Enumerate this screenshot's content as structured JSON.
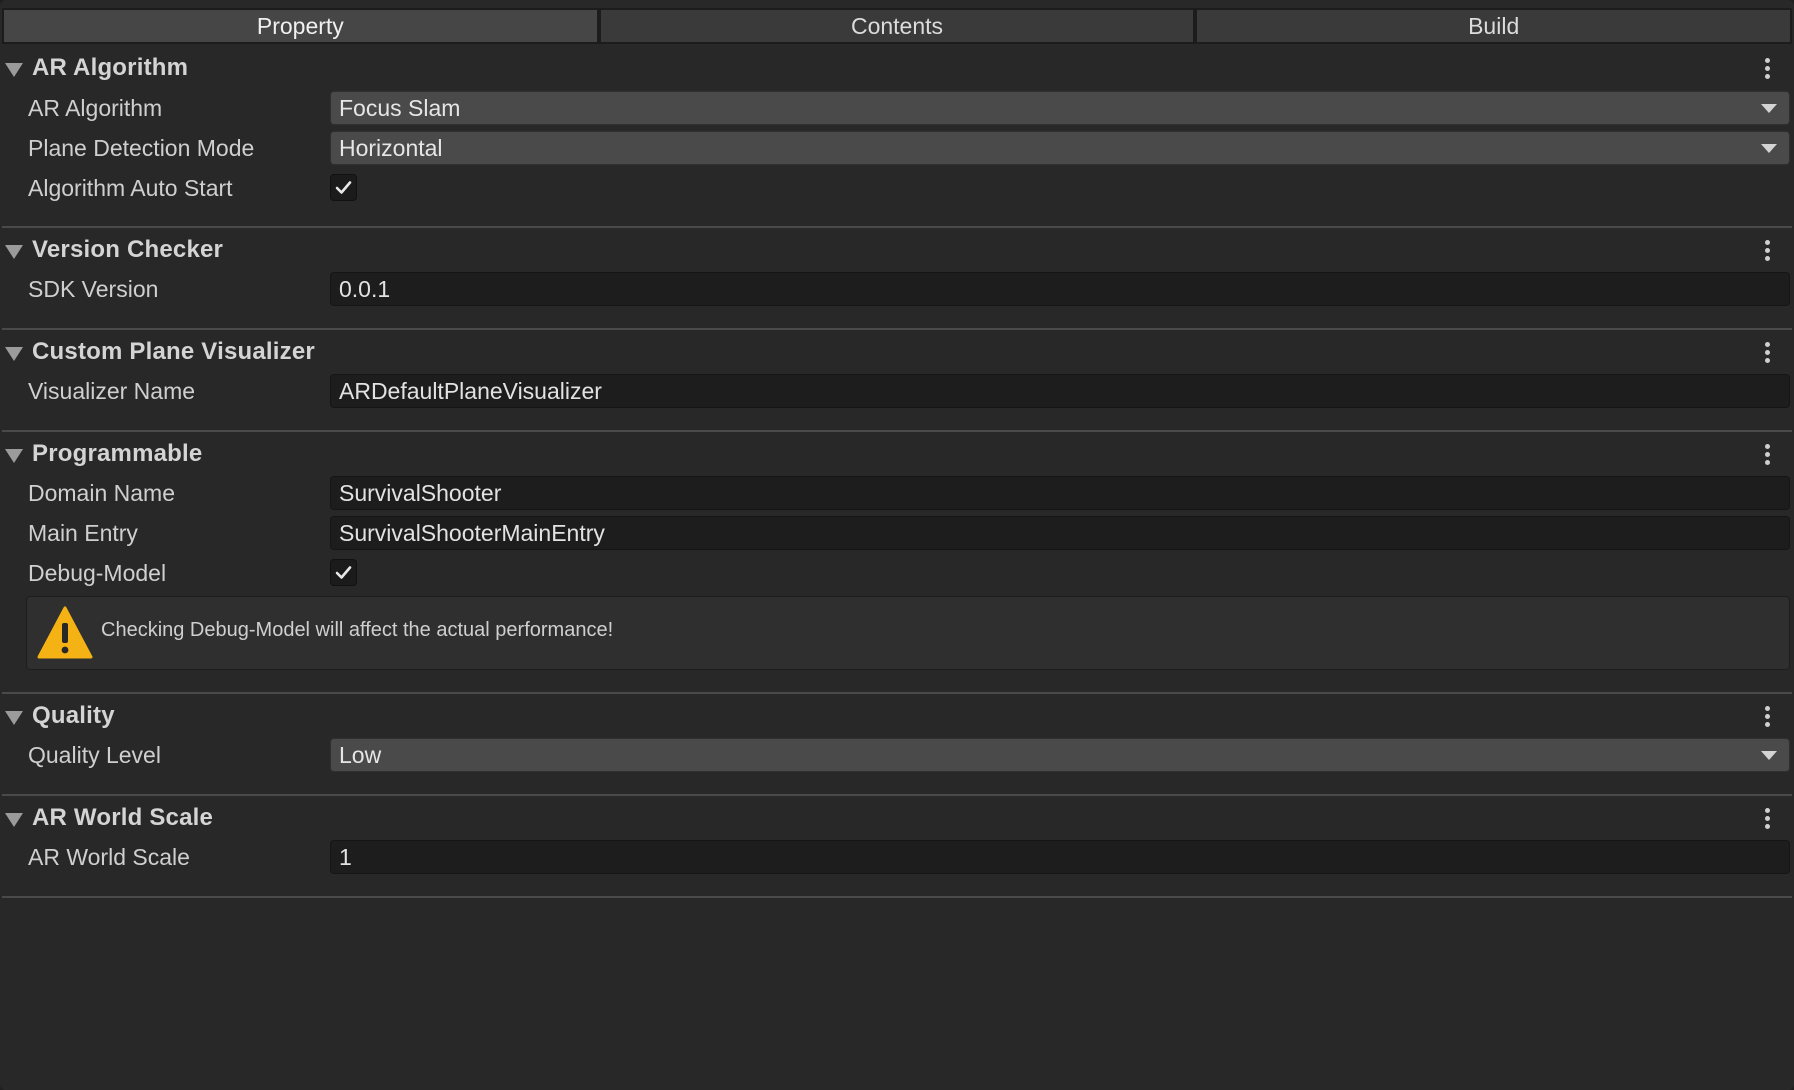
{
  "tabs": [
    {
      "label": "Property",
      "active": true
    },
    {
      "label": "Contents",
      "active": false
    },
    {
      "label": "Build",
      "active": false
    }
  ],
  "sections": {
    "ar_algorithm": {
      "title": "AR Algorithm",
      "fields": {
        "algorithm": {
          "label": "AR Algorithm",
          "value": "Focus Slam"
        },
        "plane_detection": {
          "label": "Plane Detection Mode",
          "value": "Horizontal"
        },
        "auto_start": {
          "label": "Algorithm Auto Start",
          "checked": true
        }
      }
    },
    "version_checker": {
      "title": "Version Checker",
      "fields": {
        "sdk_version": {
          "label": "SDK Version",
          "value": "0.0.1"
        }
      }
    },
    "custom_plane_visualizer": {
      "title": "Custom Plane Visualizer",
      "fields": {
        "visualizer_name": {
          "label": "Visualizer Name",
          "value": "ARDefaultPlaneVisualizer"
        }
      }
    },
    "programmable": {
      "title": "Programmable",
      "fields": {
        "domain_name": {
          "label": "Domain Name",
          "value": "SurvivalShooter"
        },
        "main_entry": {
          "label": "Main Entry",
          "value": "SurvivalShooterMainEntry"
        },
        "debug_model": {
          "label": "Debug-Model",
          "checked": true
        }
      },
      "warning": "Checking Debug-Model will affect the actual performance!"
    },
    "quality": {
      "title": "Quality",
      "fields": {
        "quality_level": {
          "label": "Quality Level",
          "value": "Low"
        }
      }
    },
    "ar_world_scale": {
      "title": "AR World Scale",
      "fields": {
        "world_scale": {
          "label": "AR World Scale",
          "value": "1"
        }
      }
    }
  },
  "colors": {
    "background": "#282828",
    "field_bg": "#1d1d1d",
    "dropdown_bg": "#4a4a4a",
    "warning": "#f5b214"
  },
  "icons": [
    "foldout-triangle-icon",
    "kebab-menu-icon",
    "dropdown-caret-icon",
    "checkmark-icon",
    "warning-icon"
  ]
}
